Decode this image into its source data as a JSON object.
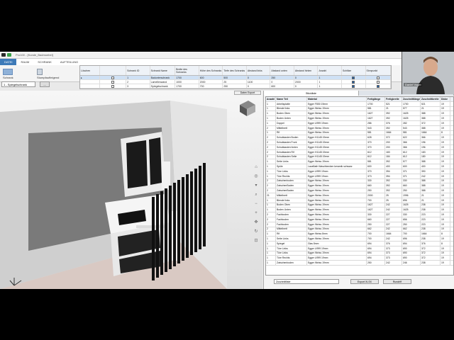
{
  "window": {
    "title": "Pro100 - [Kunde_Badmoebel]"
  },
  "ribbon_tabs": [
    "DATEI",
    "RAUM",
    "SCHRANK",
    "AUFTEILUNG"
  ],
  "ribbon": {
    "group1": "Schrank",
    "group2": "Stumpfaufteigend",
    "group3": "Bemaßung",
    "select_value": "1 - Spiegelschrank",
    "small_btn": "..."
  },
  "top_table": {
    "headers": [
      "Löschen",
      "",
      "Schrank ID",
      "Schrank Name",
      "Breite des Schranks",
      "Höhe des Schranks",
      "Tiefe des Schranks",
      "Abstand links",
      "Abstand unten",
      "Abstand hinten",
      "Anzahl",
      "Schlitze",
      "Sinnpunkt"
    ],
    "rows": [
      [
        "",
        "",
        "1",
        "Badunterschrank",
        "1700",
        "600",
        "500",
        "0",
        "250",
        "0",
        "1",
        "",
        ""
      ],
      [
        "",
        "",
        "2",
        "Lamellenwand",
        "1000",
        "2000",
        "25",
        "1100",
        "0",
        "2000",
        "1",
        "",
        ""
      ],
      [
        "",
        "",
        "3",
        "Spiegelschrank",
        "1700",
        "700",
        "250",
        "0",
        "600",
        "0",
        "1",
        "",
        ""
      ]
    ]
  },
  "viewport": {
    "export_btn": "Daten Export"
  },
  "nav_icons": [
    "home-icon",
    "target-icon",
    "down-icon",
    "search-icon",
    "zoom-out-icon",
    "zoom-in-icon",
    "move-icon",
    "rotate-icon",
    "fit-icon"
  ],
  "right_panel": {
    "tabs": [
      "Stückliste",
      "Details"
    ],
    "headers": [
      "Anzahl",
      "Name Teil",
      "Material",
      "Fertiglänge",
      "Fertigbreite",
      "Zuschnittlänge",
      "Zuschnittbreite",
      "Dicke"
    ],
    "rows": [
      [
        "1",
        "Arbeitsplatte",
        "Egger F850 19mm",
        "1700",
        "521",
        "1700",
        "521",
        "19"
      ],
      [
        "1",
        "Blende links",
        "Egger Weiss 19mm",
        "581",
        "21",
        "577",
        "21",
        "19"
      ],
      [
        "1",
        "Boden Oben",
        "Egger Weiss 19mm",
        "1627",
        "392",
        "1625",
        "388",
        "19"
      ],
      [
        "1",
        "Boden Unten",
        "Egger Weiss 19mm",
        "1627",
        "392",
        "1625",
        "388",
        "19"
      ],
      [
        "1",
        "Doppel",
        "Egger U999 19mm",
        "286",
        "376",
        "282",
        "372",
        "19"
      ],
      [
        "2",
        "Mittelbrett",
        "Egger Weiss 19mm",
        "543",
        "392",
        "543",
        "388",
        "19"
      ],
      [
        "1",
        "Rif",
        "Egger Weiss 19mm",
        "581",
        "1664",
        "581",
        "1664",
        "8"
      ],
      [
        "2",
        "Schubkasten Boden",
        "Egger H1145 19mm",
        "628",
        "372",
        "622",
        "366",
        "19"
      ],
      [
        "2",
        "Schubkasten Front",
        "Egger H1145 19mm",
        "370",
        "200",
        "366",
        "196",
        "19"
      ],
      [
        "2",
        "Schubkasten hinten",
        "Egger H1145 19mm",
        "370",
        "200",
        "366",
        "196",
        "19"
      ],
      [
        "2",
        "Schubkasten Rif",
        "Egger H1145 19mm",
        "612",
        "183",
        "612",
        "183",
        "19"
      ],
      [
        "2",
        "Schubkasten Seite",
        "Egger H1145 19mm",
        "612",
        "184",
        "612",
        "180",
        "19"
      ],
      [
        "1",
        "Seite Links",
        "Egger Weiss 19mm",
        "581",
        "392",
        "577",
        "388",
        "19"
      ],
      [
        "1",
        "Spüle",
        "LavaBath Waschbecken keramik schwarz",
        "600",
        "400",
        "600",
        "400",
        "19"
      ],
      [
        "1",
        "Türe Links",
        "Egger U999 19mm",
        "370",
        "394",
        "371",
        "390",
        "19"
      ],
      [
        "1",
        "Türe Rechts",
        "Egger U999 19mm",
        "373",
        "394",
        "371",
        "242",
        "19"
      ],
      [
        "2",
        "Zwischenboden",
        "Egger Weiss 19mm",
        "330",
        "392",
        "330",
        "388",
        "19"
      ],
      [
        "2",
        "ZwischenBoden",
        "Egger Weiss 19mm",
        "660",
        "392",
        "660",
        "388",
        "19"
      ],
      [
        "2",
        "ZwischenBoden",
        "Egger Weiss 19mm",
        "250",
        "392",
        "250",
        "388",
        "19"
      ],
      [
        "21",
        "Mittelbrett",
        "Egger Weiss 19mm",
        "2000",
        "25",
        "1996",
        "21",
        "19"
      ],
      [
        "1",
        "Blende links",
        "Egger Weiss 19mm",
        "700",
        "25",
        "696",
        "21",
        "19"
      ],
      [
        "1",
        "Boden Oben",
        "Egger Weiss 19mm",
        "1627",
        "242",
        "1625",
        "238",
        "19"
      ],
      [
        "1",
        "Boden Unten",
        "Egger Weiss 19mm",
        "1627",
        "242",
        "1625",
        "238",
        "19"
      ],
      [
        "2",
        "Fachboden",
        "Egger Weiss 19mm",
        "330",
        "227",
        "330",
        "223",
        "19"
      ],
      [
        "2",
        "Fachboden",
        "Egger Weiss 19mm",
        "660",
        "227",
        "656",
        "223",
        "19"
      ],
      [
        "2",
        "Fachboden",
        "Egger Weiss 19mm",
        "250",
        "227",
        "250",
        "223",
        "19"
      ],
      [
        "2",
        "Mittelbrett",
        "Egger Weiss 19mm",
        "662",
        "242",
        "662",
        "238",
        "19"
      ],
      [
        "1",
        "Rif",
        "Egger Weiss 8mm",
        "700",
        "1664",
        "700",
        "1664",
        "8"
      ],
      [
        "1",
        "Seite Links",
        "Egger Weiss 19mm",
        "700",
        "242",
        "696",
        "238",
        "19"
      ],
      [
        "1",
        "Spiegel",
        "Glas 8mm",
        "694",
        "376",
        "694",
        "376",
        "8"
      ],
      [
        "1",
        "Türe Links",
        "Egger U999 19mm",
        "694",
        "373",
        "690",
        "372",
        "19"
      ],
      [
        "1",
        "Türe Links",
        "Egger Weiss 19mm",
        "694",
        "373",
        "690",
        "372",
        "19"
      ],
      [
        "1",
        "Türe Rechts",
        "Egger U999 19mm",
        "694",
        "373",
        "690",
        "372",
        "19"
      ],
      [
        "1",
        "Zwischenboden",
        "Egger Weiss 19mm",
        "250",
        "242",
        "246",
        "238",
        "19"
      ]
    ],
    "foot_select": "Zuschnittliste",
    "foot_btn1": "Export XLSX",
    "foot_btn2": "Rundriff"
  },
  "webcam": {
    "label": "Daniel Vogel"
  },
  "colors": {
    "accent": "#3d7ab8",
    "selection": "#cfe1f5"
  }
}
